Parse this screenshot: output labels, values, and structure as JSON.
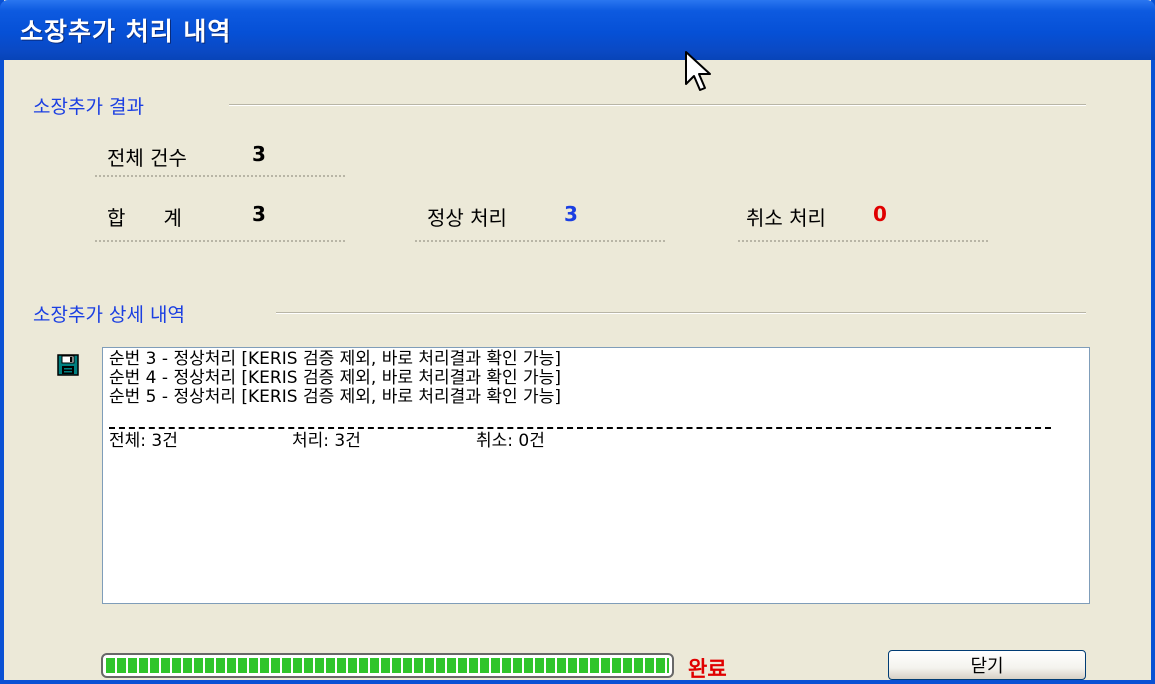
{
  "window": {
    "title": "소장추가 처리 내역"
  },
  "result_section": {
    "title": "소장추가 결과",
    "total_count_label": "전체 건수",
    "total_count_value": "3",
    "sum_label": "합      계",
    "sum_value": "3",
    "normal_label": "정상 처리",
    "normal_value": "3",
    "cancel_label": "취소 처리",
    "cancel_value": "0"
  },
  "detail_section": {
    "title": "소장추가 상세 내역",
    "save_icon": "floppy-disk-icon",
    "lines": [
      "순번 3 - 정상처리 [KERIS 검증 제외, 바로 처리결과 확인 가능]",
      "순번 4 - 정상처리 [KERIS 검증 제외, 바로 처리결과 확인 가능]",
      "순번 5 - 정상처리 [KERIS 검증 제외, 바로 처리결과 확인 가능]"
    ],
    "totals": {
      "total": "전체: 3건",
      "processed": "처리: 3건",
      "canceled": "취소: 0건"
    }
  },
  "footer": {
    "progress_percent": 100,
    "status": "완료",
    "close_label": "닫기"
  },
  "colors": {
    "title_bar": "#0650d6",
    "section_title": "#1b3fe2",
    "normal_value": "#1b3fe2",
    "cancel_value": "#e00000",
    "progress_fill": "#2fc52b",
    "status_text": "#e00000"
  }
}
